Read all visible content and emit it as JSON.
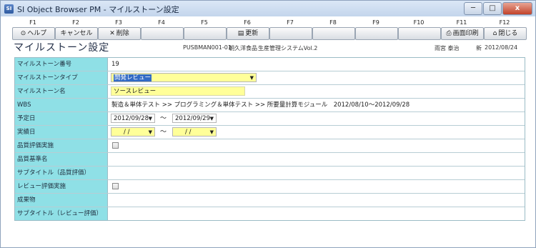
{
  "window": {
    "title": "SI Object Browser PM - マイルストーン設定",
    "app_icon_label": "SI",
    "buttons": {
      "minimize": "─",
      "maximize": "□",
      "close": "x"
    }
  },
  "fkeys": [
    "F1",
    "F2",
    "F3",
    "F4",
    "F5",
    "F6",
    "F7",
    "F8",
    "F9",
    "F10",
    "F11",
    "F12"
  ],
  "toolbar": {
    "help": {
      "label": "ヘルプ",
      "icon": "help-icon"
    },
    "cancel": {
      "label": "キャンセル"
    },
    "delete": {
      "label": "削除",
      "icon_char": "✕"
    },
    "update": {
      "label": "更新",
      "icon": "save-icon"
    },
    "print": {
      "label": "画面印刷",
      "icon": "print-icon"
    },
    "close": {
      "label": "閉じる",
      "icon": "home-icon"
    }
  },
  "header": {
    "title": "マイルストーン設定",
    "screen_id": "PUSBMAN001-01",
    "company": "朝久洋食品",
    "system": "生産管理システムVol.2",
    "user": "雨宮 泰治",
    "date_label": "新",
    "date": "2012/08/24"
  },
  "form": {
    "milestone_no": {
      "label": "マイルストーン番号",
      "value": "19"
    },
    "milestone_type": {
      "label": "マイルストーンタイプ",
      "value": "開発レビュー"
    },
    "milestone_name": {
      "label": "マイルストーン名",
      "value": "ソースレビュー"
    },
    "wbs": {
      "label": "WBS",
      "value": "製造＆単体テスト >> プログラミング＆単体テスト >> 所要量計算モジュール　2012/08/10～2012/09/28"
    },
    "planned_date": {
      "label": "予定日",
      "from": "2012/09/28",
      "to": "2012/09/29",
      "separator": "～"
    },
    "actual_date": {
      "label": "実績日",
      "from": "/ /",
      "to": "/ /",
      "separator": "～"
    },
    "quality_eval": {
      "label": "品質評価実施"
    },
    "quality_std": {
      "label": "品質基準名"
    },
    "subtitle_quality": {
      "label": "サブタイトル（品質評価）"
    },
    "review_eval": {
      "label": "レビュー評価実施"
    },
    "deliverable": {
      "label": "成果物"
    },
    "subtitle_review": {
      "label": "サブタイトル（レビュー評価）"
    }
  }
}
